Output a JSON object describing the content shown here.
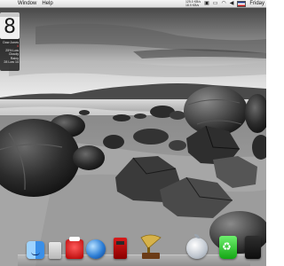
{
  "menubar": {
    "items": [
      "Window",
      "Help"
    ],
    "readout_top": "125.0 KB/s",
    "readout_bottom": "18.9 KB/s",
    "clock": "Friday"
  },
  "widget": {
    "day": "8",
    "lines": [
      "Dow Jones",
      "4",
      "25% Low",
      "Cloudy Rainy",
      "28 Low 14"
    ]
  },
  "dock": {
    "items": [
      "finder-icon",
      "files-icon",
      "red-app-icon",
      "globe-icon",
      "phone-booth-icon",
      "gramophone-icon",
      "apple-icon",
      "recycle-bin-icon",
      "dark-app-icon"
    ]
  }
}
